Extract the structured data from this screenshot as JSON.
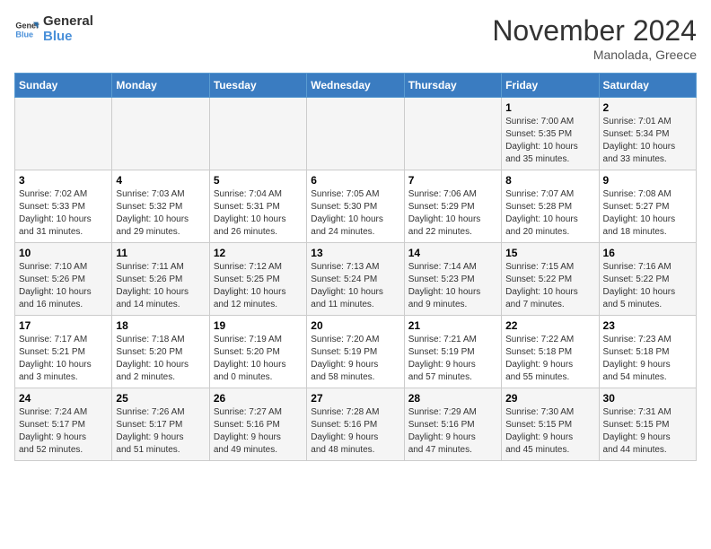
{
  "logo": {
    "line1": "General",
    "line2": "Blue"
  },
  "title": "November 2024",
  "subtitle": "Manolada, Greece",
  "days_header": [
    "Sunday",
    "Monday",
    "Tuesday",
    "Wednesday",
    "Thursday",
    "Friday",
    "Saturday"
  ],
  "weeks": [
    [
      {
        "num": "",
        "info": ""
      },
      {
        "num": "",
        "info": ""
      },
      {
        "num": "",
        "info": ""
      },
      {
        "num": "",
        "info": ""
      },
      {
        "num": "",
        "info": ""
      },
      {
        "num": "1",
        "info": "Sunrise: 7:00 AM\nSunset: 5:35 PM\nDaylight: 10 hours\nand 35 minutes."
      },
      {
        "num": "2",
        "info": "Sunrise: 7:01 AM\nSunset: 5:34 PM\nDaylight: 10 hours\nand 33 minutes."
      }
    ],
    [
      {
        "num": "3",
        "info": "Sunrise: 7:02 AM\nSunset: 5:33 PM\nDaylight: 10 hours\nand 31 minutes."
      },
      {
        "num": "4",
        "info": "Sunrise: 7:03 AM\nSunset: 5:32 PM\nDaylight: 10 hours\nand 29 minutes."
      },
      {
        "num": "5",
        "info": "Sunrise: 7:04 AM\nSunset: 5:31 PM\nDaylight: 10 hours\nand 26 minutes."
      },
      {
        "num": "6",
        "info": "Sunrise: 7:05 AM\nSunset: 5:30 PM\nDaylight: 10 hours\nand 24 minutes."
      },
      {
        "num": "7",
        "info": "Sunrise: 7:06 AM\nSunset: 5:29 PM\nDaylight: 10 hours\nand 22 minutes."
      },
      {
        "num": "8",
        "info": "Sunrise: 7:07 AM\nSunset: 5:28 PM\nDaylight: 10 hours\nand 20 minutes."
      },
      {
        "num": "9",
        "info": "Sunrise: 7:08 AM\nSunset: 5:27 PM\nDaylight: 10 hours\nand 18 minutes."
      }
    ],
    [
      {
        "num": "10",
        "info": "Sunrise: 7:10 AM\nSunset: 5:26 PM\nDaylight: 10 hours\nand 16 minutes."
      },
      {
        "num": "11",
        "info": "Sunrise: 7:11 AM\nSunset: 5:26 PM\nDaylight: 10 hours\nand 14 minutes."
      },
      {
        "num": "12",
        "info": "Sunrise: 7:12 AM\nSunset: 5:25 PM\nDaylight: 10 hours\nand 12 minutes."
      },
      {
        "num": "13",
        "info": "Sunrise: 7:13 AM\nSunset: 5:24 PM\nDaylight: 10 hours\nand 11 minutes."
      },
      {
        "num": "14",
        "info": "Sunrise: 7:14 AM\nSunset: 5:23 PM\nDaylight: 10 hours\nand 9 minutes."
      },
      {
        "num": "15",
        "info": "Sunrise: 7:15 AM\nSunset: 5:22 PM\nDaylight: 10 hours\nand 7 minutes."
      },
      {
        "num": "16",
        "info": "Sunrise: 7:16 AM\nSunset: 5:22 PM\nDaylight: 10 hours\nand 5 minutes."
      }
    ],
    [
      {
        "num": "17",
        "info": "Sunrise: 7:17 AM\nSunset: 5:21 PM\nDaylight: 10 hours\nand 3 minutes."
      },
      {
        "num": "18",
        "info": "Sunrise: 7:18 AM\nSunset: 5:20 PM\nDaylight: 10 hours\nand 2 minutes."
      },
      {
        "num": "19",
        "info": "Sunrise: 7:19 AM\nSunset: 5:20 PM\nDaylight: 10 hours\nand 0 minutes."
      },
      {
        "num": "20",
        "info": "Sunrise: 7:20 AM\nSunset: 5:19 PM\nDaylight: 9 hours\nand 58 minutes."
      },
      {
        "num": "21",
        "info": "Sunrise: 7:21 AM\nSunset: 5:19 PM\nDaylight: 9 hours\nand 57 minutes."
      },
      {
        "num": "22",
        "info": "Sunrise: 7:22 AM\nSunset: 5:18 PM\nDaylight: 9 hours\nand 55 minutes."
      },
      {
        "num": "23",
        "info": "Sunrise: 7:23 AM\nSunset: 5:18 PM\nDaylight: 9 hours\nand 54 minutes."
      }
    ],
    [
      {
        "num": "24",
        "info": "Sunrise: 7:24 AM\nSunset: 5:17 PM\nDaylight: 9 hours\nand 52 minutes."
      },
      {
        "num": "25",
        "info": "Sunrise: 7:26 AM\nSunset: 5:17 PM\nDaylight: 9 hours\nand 51 minutes."
      },
      {
        "num": "26",
        "info": "Sunrise: 7:27 AM\nSunset: 5:16 PM\nDaylight: 9 hours\nand 49 minutes."
      },
      {
        "num": "27",
        "info": "Sunrise: 7:28 AM\nSunset: 5:16 PM\nDaylight: 9 hours\nand 48 minutes."
      },
      {
        "num": "28",
        "info": "Sunrise: 7:29 AM\nSunset: 5:16 PM\nDaylight: 9 hours\nand 47 minutes."
      },
      {
        "num": "29",
        "info": "Sunrise: 7:30 AM\nSunset: 5:15 PM\nDaylight: 9 hours\nand 45 minutes."
      },
      {
        "num": "30",
        "info": "Sunrise: 7:31 AM\nSunset: 5:15 PM\nDaylight: 9 hours\nand 44 minutes."
      }
    ]
  ]
}
